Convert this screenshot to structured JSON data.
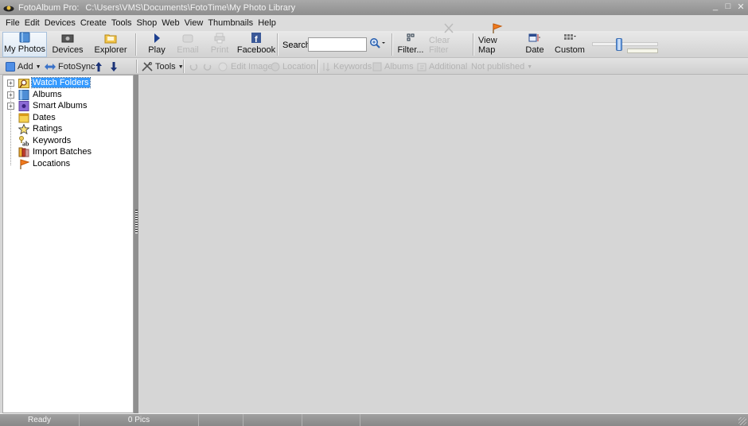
{
  "window": {
    "app_name": "FotoAlbum Pro:",
    "path": "C:\\Users\\VMS\\Documents\\FotoTime\\My Photo Library",
    "controls": {
      "minimize": "_",
      "maximize": "□",
      "close": "✕"
    }
  },
  "menu": [
    "File",
    "Edit",
    "Devices",
    "Create",
    "Tools",
    "Shop",
    "Web",
    "View",
    "Thumbnails",
    "Help"
  ],
  "toolbar": {
    "views": [
      {
        "label": "My Photos",
        "icon": "photo-album-icon",
        "selected": true
      },
      {
        "label": "Devices",
        "icon": "camera-icon",
        "selected": false
      },
      {
        "label": "Explorer",
        "icon": "folder-icon",
        "selected": false
      }
    ],
    "actions": [
      {
        "label": "Play",
        "icon": "play-icon",
        "enabled": true
      },
      {
        "label": "Email",
        "icon": "email-icon",
        "enabled": false
      },
      {
        "label": "Print",
        "icon": "print-icon",
        "enabled": false
      },
      {
        "label": "Facebook",
        "icon": "facebook-icon",
        "enabled": true
      }
    ],
    "search": {
      "label": "Search",
      "value": "",
      "placeholder": ""
    },
    "filter": {
      "label": "Filter...",
      "enabled": true
    },
    "clear_filter": {
      "label": "Clear Filter",
      "enabled": false
    },
    "view_map": {
      "label": "View Map"
    },
    "sort_date": {
      "label": "Date"
    },
    "custom": {
      "label": "Custom"
    },
    "thumbnail_size_slider": {
      "value_fraction": 0.4
    }
  },
  "subtoolbar": {
    "add": {
      "label": "Add"
    },
    "fotosync": {
      "label": "FotoSync"
    },
    "tools": {
      "label": "Tools"
    },
    "edit_image": {
      "label": "Edit Image",
      "enabled": false
    },
    "location": {
      "label": "Location",
      "enabled": false
    },
    "keywords": {
      "label": "Keywords",
      "enabled": false
    },
    "albums": {
      "label": "Albums",
      "enabled": false
    },
    "additional": {
      "label": "Additional",
      "enabled": false
    },
    "publish_state": {
      "label": "Not published",
      "enabled": false
    }
  },
  "tree": [
    {
      "label": "Watch Folders",
      "icon": "watch-folder-icon",
      "expandable": true,
      "selected": true
    },
    {
      "label": "Albums",
      "icon": "albums-icon",
      "expandable": true,
      "selected": false
    },
    {
      "label": "Smart Albums",
      "icon": "smart-albums-icon",
      "expandable": true,
      "selected": false
    },
    {
      "label": "Dates",
      "icon": "calendar-icon",
      "expandable": false,
      "selected": false
    },
    {
      "label": "Ratings",
      "icon": "star-icon",
      "expandable": false,
      "selected": false
    },
    {
      "label": "Keywords",
      "icon": "keywords-icon",
      "expandable": false,
      "selected": false
    },
    {
      "label": "Import Batches",
      "icon": "import-batches-icon",
      "expandable": false,
      "selected": false
    },
    {
      "label": "Locations",
      "icon": "flag-icon",
      "expandable": false,
      "selected": false
    }
  ],
  "status": {
    "state": "Ready",
    "pic_count": "0 Pics"
  }
}
